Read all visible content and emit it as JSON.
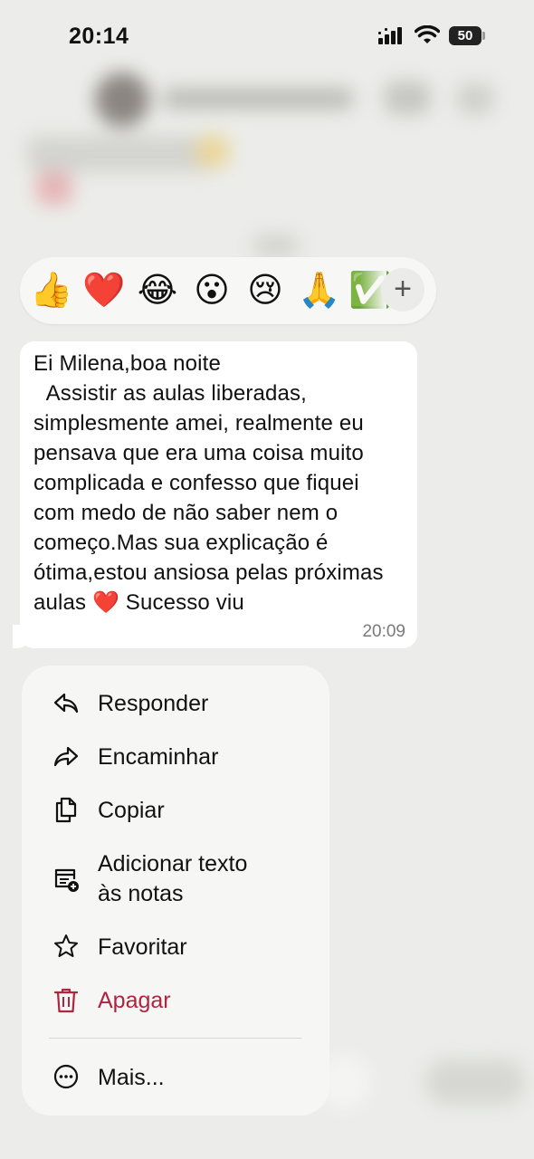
{
  "status_bar": {
    "time": "20:14",
    "battery": "50"
  },
  "reactions": {
    "emojis": [
      {
        "name": "thumbs-up",
        "glyph": "👍"
      },
      {
        "name": "red-heart",
        "glyph": "❤️"
      },
      {
        "name": "tears-of-joy",
        "glyph": "😂"
      },
      {
        "name": "surprised",
        "glyph": "😮"
      },
      {
        "name": "crying",
        "glyph": "😢"
      },
      {
        "name": "folded-hands",
        "glyph": "🙏"
      },
      {
        "name": "check-mark",
        "glyph": "✅"
      }
    ],
    "more_label": "+"
  },
  "message": {
    "text": "Ei Milena,boa noite\n  Assistir as aulas liberadas, simplesmente amei, realmente eu pensava que era uma coisa muito complicada e confesso que fiquei com medo de não saber nem o começo.Mas sua explicação é ótima,estou ansiosa pelas próximas aulas ❤️ Sucesso viu",
    "time": "20:09"
  },
  "menu": {
    "items": [
      {
        "label": "Responder",
        "icon": "reply-icon"
      },
      {
        "label": "Encaminhar",
        "icon": "forward-icon"
      },
      {
        "label": "Copiar",
        "icon": "copy-icon"
      },
      {
        "label": "Adicionar texto\nàs notas",
        "icon": "add-to-notes-icon"
      },
      {
        "label": "Favoritar",
        "icon": "star-icon"
      },
      {
        "label": "Apagar",
        "icon": "trash-icon",
        "color": "#b0243f"
      },
      {
        "label": "Mais...",
        "icon": "more-icon"
      }
    ]
  },
  "colors": {
    "background": "#ecedea",
    "danger": "#b0243f",
    "bubble": "#ffffff",
    "menu": "#f6f6f5"
  }
}
